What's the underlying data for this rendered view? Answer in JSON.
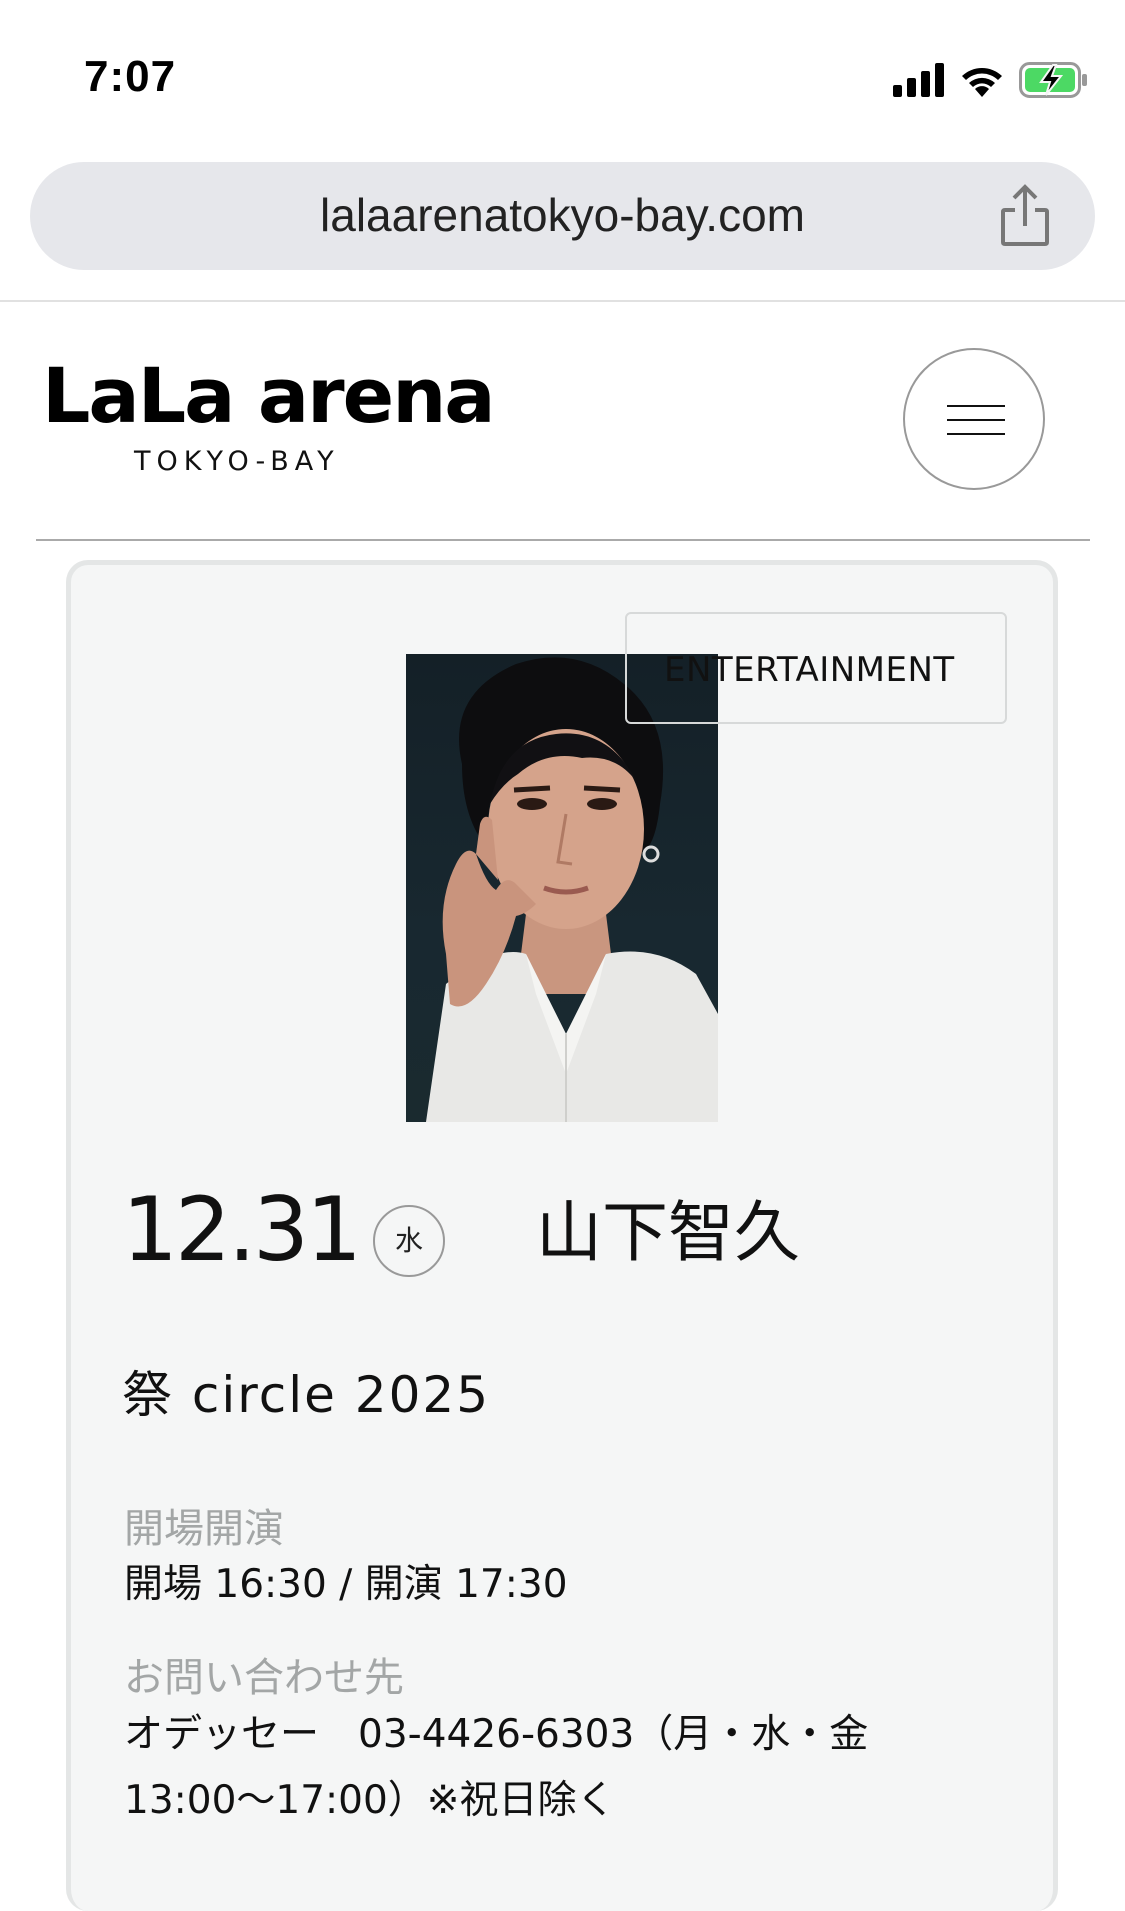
{
  "status_bar": {
    "time": "7:07",
    "icons": [
      "cellular-signal-icon",
      "wifi-icon",
      "battery-charging-icon"
    ],
    "battery_color": "#4cd964"
  },
  "browser": {
    "url": "lalaarenatokyo-bay.com",
    "share_icon": "share-icon"
  },
  "header": {
    "logo_main": "LaLa arena",
    "logo_sub": "TOKYO-BAY",
    "menu_icon": "hamburger-menu-icon"
  },
  "event": {
    "category": "ENTERTAINMENT",
    "date": "12.31",
    "weekday": "水",
    "artist": "山下智久",
    "title": "祭 circle 2025",
    "open_label": "開場開演",
    "open_value": "開場 16:30 / 開演 17:30",
    "contact_label": "お問い合わせ先",
    "contact_value": "オデッセー　03-4426-6303（月・水・金 13:00〜17:00）※祝日除く"
  }
}
